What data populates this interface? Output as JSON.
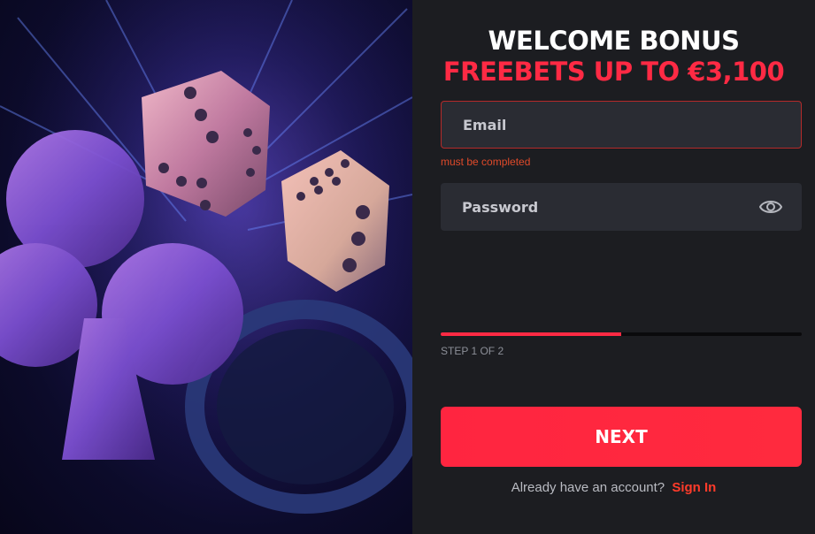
{
  "header": {
    "title": "WELCOME BONUS",
    "subtitle": "FREEBETS UP TO €3,100"
  },
  "form": {
    "email_placeholder": "Email",
    "email_value": "",
    "email_error": "must be completed",
    "password_placeholder": "Password",
    "password_value": "",
    "password_toggle_icon": "eye-icon"
  },
  "progress": {
    "fraction": 0.5,
    "step_text": "STEP 1 OF 2"
  },
  "actions": {
    "next_label": "NEXT",
    "signin_prompt": "Already have an account?",
    "signin_link": "Sign In"
  },
  "colors": {
    "accent": "#ff2a44",
    "panel_bg": "#1c1d21",
    "field_bg": "#2a2c33",
    "error": "#e04a2a"
  }
}
